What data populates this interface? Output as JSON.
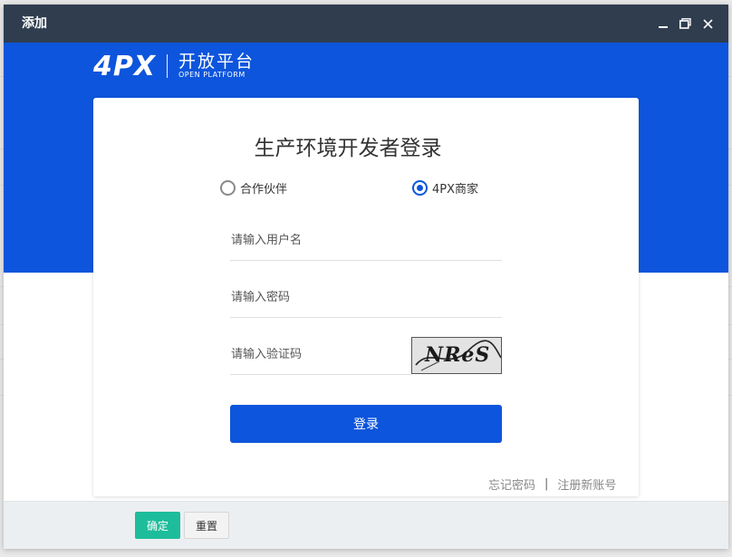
{
  "window": {
    "title": "添加"
  },
  "logo": {
    "mark": "4PX",
    "name_cn": "开放平台",
    "name_en": "OPEN PLATFORM"
  },
  "login": {
    "title": "生产环境开发者登录",
    "account_types": [
      {
        "label": "合作伙伴",
        "selected": false
      },
      {
        "label": "4PX商家",
        "selected": true
      }
    ],
    "username_placeholder": "请输入用户名",
    "password_placeholder": "请输入密码",
    "captcha_placeholder": "请输入验证码",
    "captcha_text": "NReS",
    "login_label": "登录",
    "forgot_password": "忘记密码",
    "separator": "|",
    "register": "注册新账号"
  },
  "footer": {
    "confirm_label": "确定",
    "reset_label": "重置"
  },
  "colors": {
    "brand_blue": "#0d55dc",
    "titlebar": "#2f3d4f",
    "confirm_green": "#1dbd9b"
  },
  "icons": {
    "minimize": "minimize-icon",
    "maximize": "maximize-icon",
    "close": "close-icon"
  }
}
